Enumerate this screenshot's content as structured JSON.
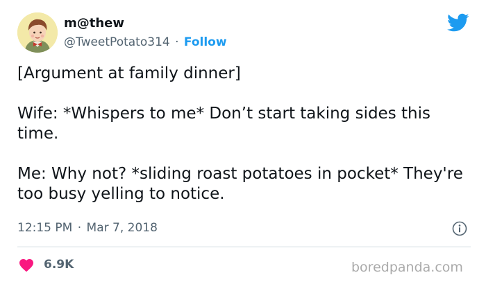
{
  "author": {
    "name": "m@thew",
    "handle": "@TweetPotato314",
    "separator": "·",
    "follow_label": "Follow"
  },
  "tweet": {
    "paragraphs": [
      "[Argument at family dinner]",
      "Wife: *Whispers to me* Don’t start taking sides this time.",
      "Me: Why not? *sliding roast potatoes in pocket* They're too busy yelling to notice."
    ],
    "time": "12:15 PM",
    "meta_separator": "·",
    "date": "Mar 7, 2018"
  },
  "stats": {
    "likes": "6.9K"
  },
  "watermark": "boredpanda.com",
  "icons": {
    "brand": "twitter-bird-icon",
    "info": "info-icon",
    "like": "heart-icon"
  },
  "colors": {
    "accent": "#1d9bf0",
    "heart": "#f91880",
    "muted_text": "#536471",
    "divider": "#cfd9de"
  }
}
